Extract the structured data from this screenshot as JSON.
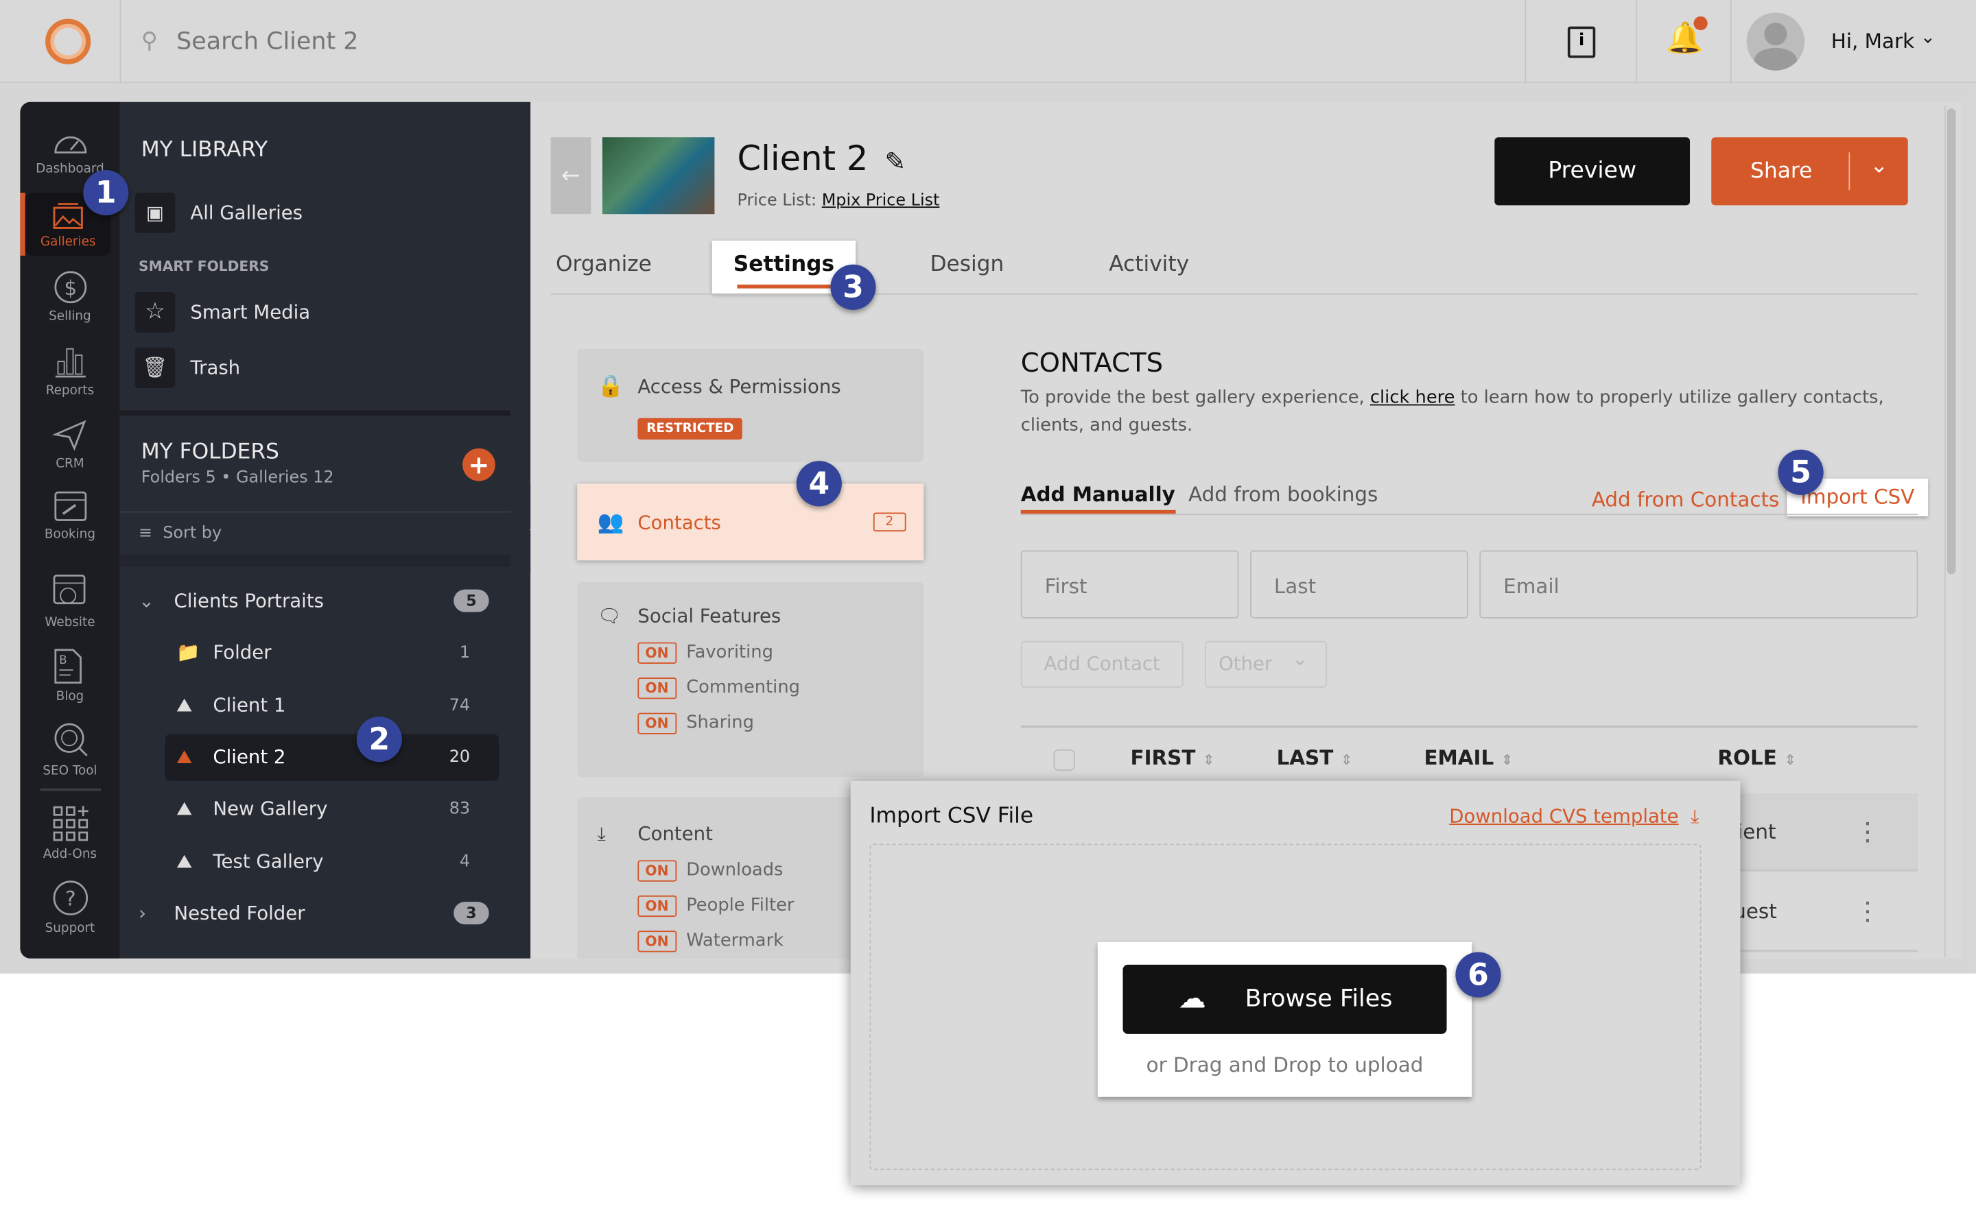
{
  "topbar": {
    "search_placeholder": "Search Client 2",
    "greeting": "Hi, Mark",
    "icons": [
      "logo-ring",
      "search-icon",
      "guide-book-icon",
      "bell-icon",
      "avatar",
      "chevron-down-icon"
    ]
  },
  "rail": {
    "items": [
      {
        "label": "Dashboard",
        "icon": "gauge-icon"
      },
      {
        "label": "Galleries",
        "icon": "gallery-icon",
        "active": true
      },
      {
        "label": "Selling",
        "icon": "dollar-icon"
      },
      {
        "label": "Reports",
        "icon": "bar-chart-icon"
      },
      {
        "label": "CRM",
        "icon": "paper-plane-icon"
      },
      {
        "label": "Booking",
        "icon": "calendar-icon"
      },
      {
        "label": "Website",
        "icon": "website-icon"
      },
      {
        "label": "Blog",
        "icon": "blog-icon"
      },
      {
        "label": "SEO Tool",
        "icon": "seo-icon"
      },
      {
        "label": "Add-Ons",
        "icon": "grid-plus-icon"
      },
      {
        "label": "Support",
        "icon": "question-icon"
      }
    ]
  },
  "library": {
    "title": "MY LIBRARY",
    "all_galleries": "All Galleries",
    "smart_folders_title": "SMART FOLDERS",
    "smart_media": "Smart Media",
    "trash": "Trash",
    "folders_title": "MY FOLDERS",
    "folders_meta": "Folders 5 • Galleries 12",
    "sort_by": "Sort by",
    "tree": [
      {
        "label": "Clients Portraits",
        "count": "5",
        "expanded": true
      },
      {
        "label": "Folder",
        "count": "1"
      },
      {
        "label": "Client 1",
        "count": "74"
      },
      {
        "label": "Client 2",
        "count": "20",
        "selected": true
      },
      {
        "label": "New Gallery",
        "count": "83"
      },
      {
        "label": "Test Gallery",
        "count": "4"
      },
      {
        "label": "Nested Folder",
        "count": "3"
      }
    ]
  },
  "header": {
    "title": "Client 2",
    "price_list_label": "Price List:",
    "price_list": "Mpix Price List",
    "preview": "Preview",
    "share": "Share"
  },
  "tabs": [
    "Organize",
    "Settings",
    "Design",
    "Activity"
  ],
  "settings_nav": {
    "access": "Access & Permissions",
    "restricted": "RESTRICTED",
    "contacts": "Contacts",
    "contacts_count": "2",
    "social": "Social Features",
    "social_items": [
      "Favoriting",
      "Commenting",
      "Sharing"
    ],
    "content": "Content",
    "content_items": [
      "Downloads",
      "People Filter",
      "Watermark"
    ],
    "on": "ON"
  },
  "contacts": {
    "title": "CONTACTS",
    "desc_pre": "To provide the best gallery experience, ",
    "desc_link": "click here",
    "desc_post": " to learn how to properly utilize gallery contacts, clients, and guests.",
    "tab_manual": "Add Manually",
    "tab_bookings": "Add from bookings",
    "add_from_contacts": "Add from Contacts",
    "import_csv": "Import CSV",
    "first_ph": "First",
    "last_ph": "Last",
    "email_ph": "Email",
    "add_contact": "Add Contact",
    "role_select": "Other",
    "columns": [
      "FIRST",
      "LAST",
      "EMAIL",
      "ROLE"
    ],
    "rows": [
      {
        "role": "Client"
      },
      {
        "role": "Guest"
      }
    ]
  },
  "csv_modal": {
    "title": "Import CSV File",
    "download": "Download CVS template",
    "browse": "Browse Files",
    "drag": "or Drag and Drop to upload"
  },
  "callouts": [
    "1",
    "2",
    "3",
    "4",
    "5",
    "6"
  ],
  "colors": {
    "accent": "#d4582a",
    "callout": "#33449a",
    "rail": "#1c1d22",
    "library": "#272b34"
  }
}
